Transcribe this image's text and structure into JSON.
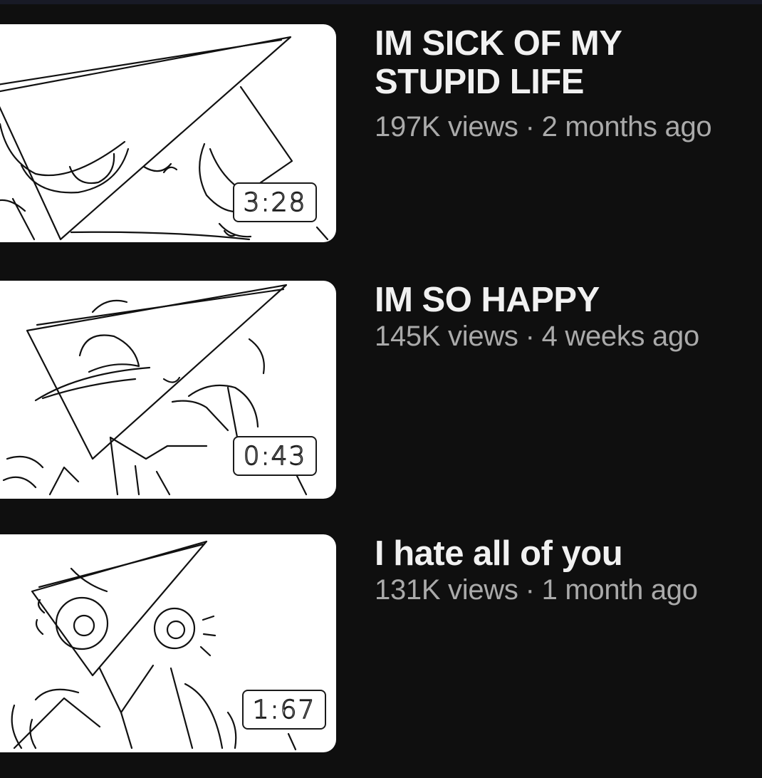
{
  "videos": [
    {
      "title": "IM SICK OF MY STUPID LIFE",
      "views": "197K views",
      "separator": "·",
      "age": "2 months ago",
      "duration": "3:28"
    },
    {
      "title": "IM SO HAPPY",
      "views": "145K views",
      "separator": "·",
      "age": "4 weeks ago",
      "duration": "0:43"
    },
    {
      "title": "I hate all of you",
      "views": "131K views",
      "separator": "·",
      "age": "1 month ago",
      "duration": "1:67"
    }
  ],
  "colors": {
    "background": "#0f0f0f",
    "title": "#f1f1f1",
    "meta": "#aaaaaa",
    "thumbnail": "#ffffff"
  }
}
